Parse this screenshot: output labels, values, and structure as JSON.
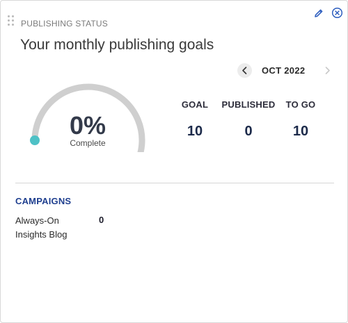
{
  "widget": {
    "label": "PUBLISHING STATUS",
    "title": "Your monthly publishing goals"
  },
  "month_nav": {
    "current": "OCT 2022"
  },
  "progress": {
    "percent_text": "0%",
    "caption": "Complete",
    "fraction": 0.0
  },
  "stats": [
    {
      "label": "GOAL",
      "value": "10"
    },
    {
      "label": "PUBLISHED",
      "value": "0"
    },
    {
      "label": "TO GO",
      "value": "10"
    }
  ],
  "campaigns": {
    "heading": "CAMPAIGNS",
    "items": [
      {
        "name": "Always-On Insights Blog",
        "count": "0"
      }
    ]
  },
  "colors": {
    "gauge_track": "#cfcfcf",
    "gauge_marker": "#4ec1c6",
    "heading_blue": "#1f3f8f",
    "icon_blue": "#2f5fbf"
  }
}
